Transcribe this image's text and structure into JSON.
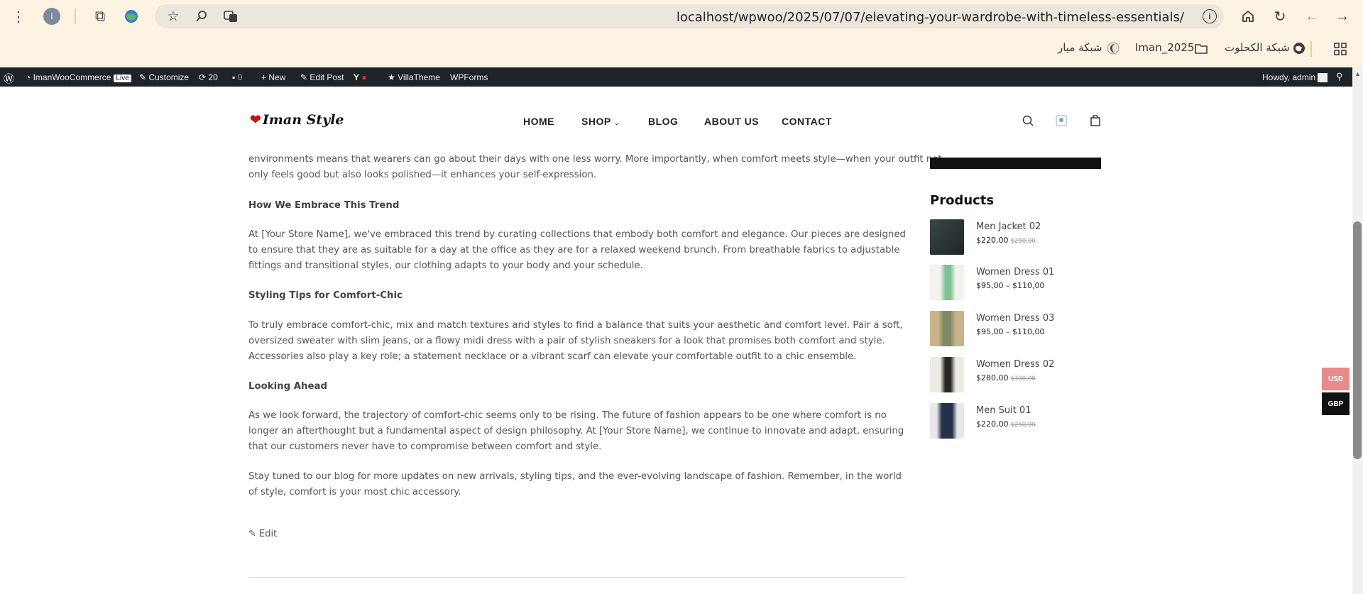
{
  "browser": {
    "profile_initial": "I",
    "url": "localhost/wpwoo/2025/07/07/elevating-your-wardrobe-with-timeless-essentials/",
    "bookmarks": [
      "شبكة الكحلوت",
      "Iman_2025",
      "شبكة ميار"
    ]
  },
  "adminbar": {
    "site_name": "ImanWooCommerce",
    "live_badge": "Live",
    "customize": "Customize",
    "updates": "20",
    "comments": "0",
    "new": "New",
    "edit_post": "Edit Post",
    "villatheme": "VillaTheme",
    "wpforms": "WPForms",
    "howdy": "Howdy, admin"
  },
  "header": {
    "logo_text": "Iman Style",
    "nav": [
      "HOME",
      "SHOP",
      "BLOG",
      "ABOUT US",
      "CONTACT"
    ]
  },
  "article": {
    "intro_line1": "environments means that wearers can go about their days with one less worry. More importantly, when comfort meets style—when your outfit not",
    "intro_line2": "only feels good but also looks polished—it enhances your self-expression.",
    "h1": "How We Embrace This Trend",
    "p1": "At [Your Store Name], we've embraced this trend by curating collections that embody both comfort and elegance. Our pieces are designed to ensure that they are as suitable for a day at the office as they are for a relaxed weekend brunch. From breathable fabrics to adjustable fittings and transitional styles, our clothing adapts to your body and your schedule.",
    "h2": "Styling Tips for Comfort-Chic",
    "p2": "To truly embrace comfort-chic, mix and match textures and styles to find a balance that suits your aesthetic and comfort level. Pair a soft, oversized sweater with slim jeans, or a flowy midi dress with a pair of stylish sneakers for a look that promises both comfort and style. Accessories also play a key role; a statement necklace or a vibrant scarf can elevate your comfortable outfit to a chic ensemble.",
    "h3": "Looking Ahead",
    "p3": "As we look forward, the trajectory of comfort-chic seems only to be rising. The future of fashion appears to be one where comfort is no longer an afterthought but a fundamental aspect of design philosophy. At [Your Store Name], we continue to innovate and adapt, ensuring that our customers never have to compromise between comfort and style.",
    "p4": "Stay tuned to our blog for more updates on new arrivals, styling tips, and the ever-evolving landscape of fashion. Remember, in the world of style, comfort is your most chic accessory.",
    "edit_link": "Edit"
  },
  "sidebar": {
    "title": "Products",
    "products": [
      {
        "name": "Men Jacket 02",
        "price": "$220,00",
        "old": "$250,00",
        "color": "#2f3a3a"
      },
      {
        "name": "Women Dress 01",
        "price": "$95,00 – $110,00",
        "old": "",
        "color": "#8fc79a"
      },
      {
        "name": "Women Dress 03",
        "price": "$95,00 – $110,00",
        "old": "",
        "color": "#8a8a6a"
      },
      {
        "name": "Women Dress 02",
        "price": "$280,00",
        "old": "$300,00",
        "color": "#2a2624"
      },
      {
        "name": "Men Suit 01",
        "price": "$220,00",
        "old": "$250,00",
        "color": "#25304a"
      }
    ]
  },
  "currency": {
    "usd": "USD",
    "gbp": "GBP"
  }
}
